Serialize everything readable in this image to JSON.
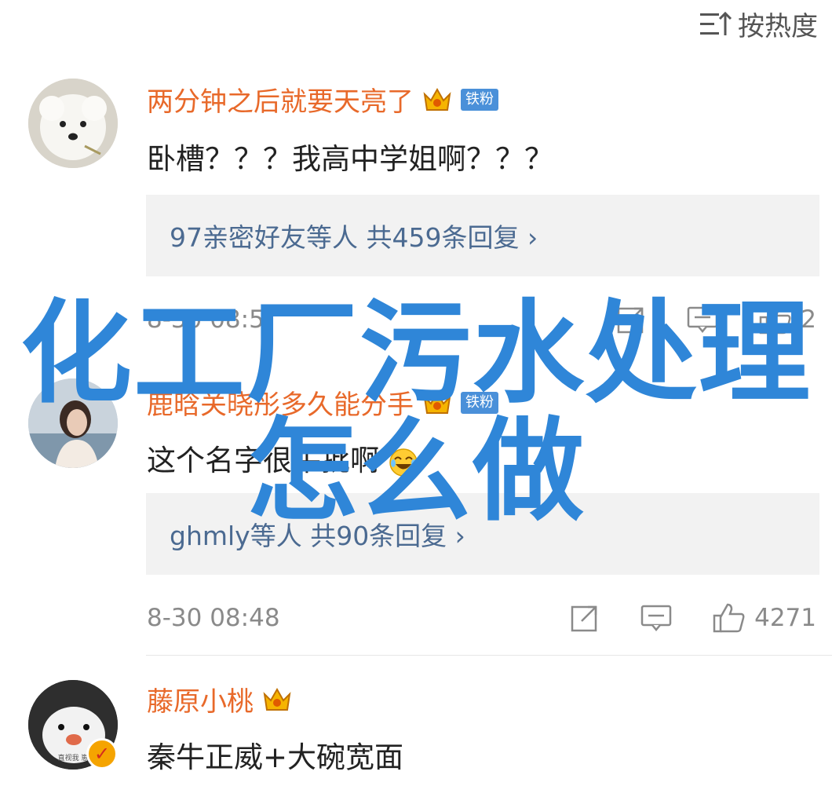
{
  "sort": {
    "label": "按热度"
  },
  "comments": [
    {
      "username": "两分钟之后就要天亮了",
      "fan_badge": "铁粉",
      "text": "卧槽？？？我高中学姐啊？？？",
      "reply_summary": "97亲密好友等人  共459条回复 ›",
      "time": "8-30 08:5",
      "likes": "2"
    },
    {
      "username": "鹿晗关晓彤多久能分手",
      "fan_badge": "铁粉",
      "text": "这个名字很牛批啊",
      "reply_summary": "ghmly等人  共90条回复 ›",
      "time": "8-30 08:48",
      "likes": "4271"
    },
    {
      "username": "藤原小桃",
      "text": "秦牛正威+大碗宽面",
      "avatar_caption": "直视我  崽"
    }
  ],
  "overlay": {
    "line1": "化工厂污水处理",
    "line2": "怎么做"
  },
  "colors": {
    "username": "#e8692a",
    "reply_link": "#4b6a91",
    "overlay": "#2f86d8",
    "fan_badge": "#4a90d9"
  }
}
